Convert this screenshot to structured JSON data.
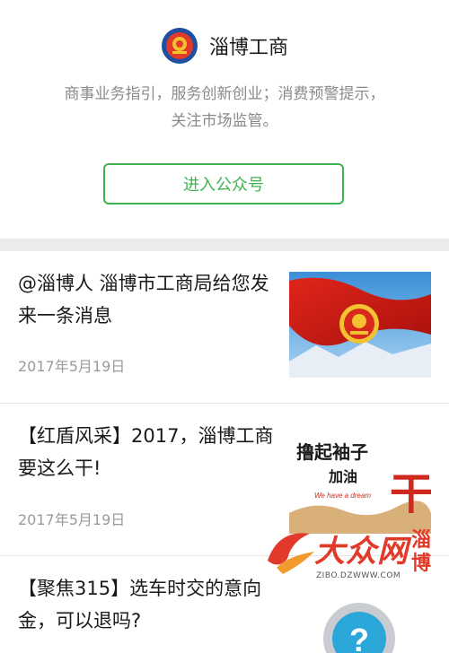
{
  "account": {
    "name": "淄博工商",
    "description_line1": "商事业务指引，服务创新创业；消费预警提示，",
    "description_line2": "关注市场监管。",
    "follow_button": "进入公众号"
  },
  "articles": [
    {
      "title": "@淄博人 淄博市工商局给您发来一条消息",
      "date": "2017年5月19日"
    },
    {
      "title": "【红盾风采】2017，淄博工商要这么干!",
      "date": "2017年5月19日",
      "thumb_text_main": "撸起袖子",
      "thumb_text_sub": "加油",
      "thumb_text_en": "We have a dream",
      "thumb_text_big": "干"
    },
    {
      "title": "【聚焦315】选车时交的意向金，可以退吗?"
    }
  ],
  "watermark": {
    "logo_text": "大众网",
    "side_text": "淄博",
    "url": "ZIBO.DZWWW.COM"
  },
  "colors": {
    "accent_green": "#3fb34f",
    "watermark_red": "#e23a2a"
  }
}
